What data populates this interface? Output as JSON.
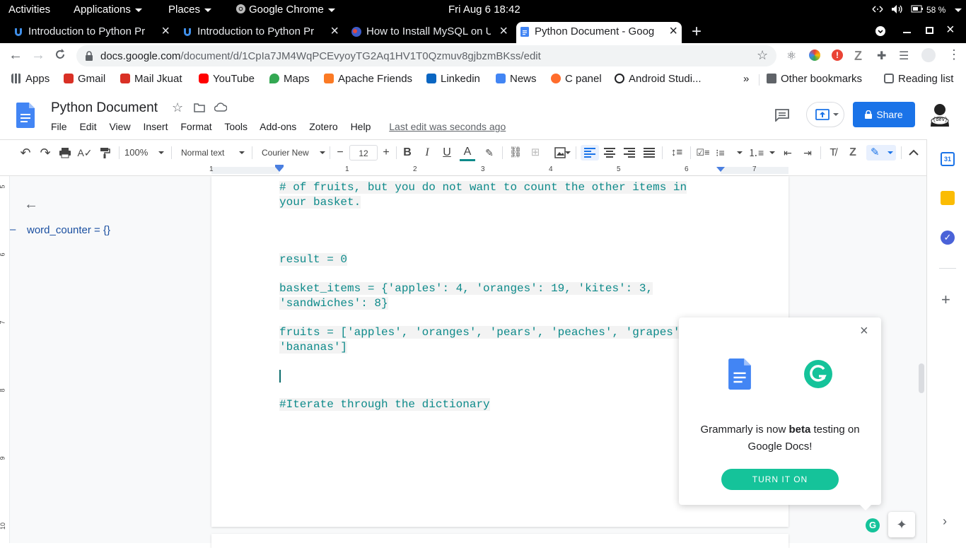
{
  "gnome": {
    "activities": "Activities",
    "applications": "Applications",
    "places": "Places",
    "app": "Google Chrome",
    "clock": "Fri Aug 6  18:42",
    "battery": "58 %"
  },
  "tabs": [
    {
      "title": "Introduction to Python Pr",
      "color": "#3f8ee8"
    },
    {
      "title": "Introduction to Python Pr",
      "color": "#3f8ee8"
    },
    {
      "title": "How to Install MySQL on U",
      "color": "#4f6fd0"
    },
    {
      "title": "Python Document - Goog",
      "color": "#4285f4"
    }
  ],
  "omnibox": {
    "host": "docs.google.com",
    "path": "/document/d/1CpIa7JM4WqPCEvyoyTG2Aq1HV1T0Qzmuv8gjbzmBKss/edit"
  },
  "bookmarks": [
    {
      "label": "Apps",
      "color": "#5f6368"
    },
    {
      "label": "Gmail",
      "color": "#d93025"
    },
    {
      "label": "Mail Jkuat",
      "color": "#d93025"
    },
    {
      "label": "YouTube",
      "color": "#ff0000"
    },
    {
      "label": "Maps",
      "color": "#34a853"
    },
    {
      "label": "Apache Friends",
      "color": "#fb7a24"
    },
    {
      "label": "Linkedin",
      "color": "#0a66c2"
    },
    {
      "label": "News",
      "color": "#4285f4"
    },
    {
      "label": "C panel",
      "color": "#ff6c2c"
    },
    {
      "label": "Android Studi...",
      "color": "#202124"
    }
  ],
  "bookmarks_more": "»",
  "other_bookmarks": "Other bookmarks",
  "reading_list": "Reading list",
  "doc": {
    "title": "Python Document",
    "menu": [
      "File",
      "Edit",
      "View",
      "Insert",
      "Format",
      "Tools",
      "Add-ons",
      "Zotero",
      "Help"
    ],
    "last_edit": "Last edit was seconds ago",
    "share": "Share",
    "avatar_text": "{dev}"
  },
  "toolbar": {
    "zoom": "100%",
    "style": "Normal text",
    "font": "Courier New",
    "size": "12"
  },
  "ruler": [
    "1",
    "1",
    "2",
    "3",
    "4",
    "5",
    "6",
    "7"
  ],
  "vruler": [
    "5",
    "6",
    "7",
    "8",
    "9",
    "10"
  ],
  "outline": {
    "item": "word_counter = {}"
  },
  "code": {
    "line1": "# of fruits, but you do not want to count the other items in",
    "line2": "your basket.",
    "line3": "result = 0",
    "line4": "basket_items = {'apples': 4, 'oranges': 19, 'kites': 3,",
    "line5": "'sandwiches': 8}",
    "line6": "fruits = ['apples', 'oranges', 'pears', 'peaches', 'grapes',",
    "line7": "'bananas']",
    "line8": "#Iterate through the dictionary"
  },
  "grammarly": {
    "msg_pre": "Grammarly is now ",
    "msg_bold": "beta",
    "msg_post": " testing on Google Docs!",
    "button": "TURN IT ON"
  }
}
